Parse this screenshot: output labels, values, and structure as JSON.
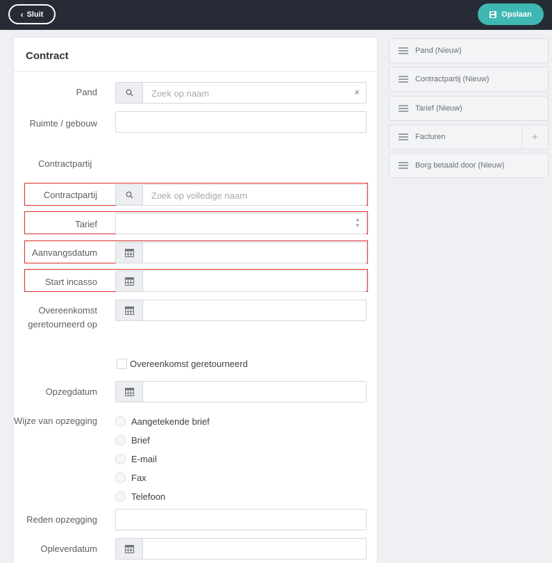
{
  "topbar": {
    "close_label": "Sluit",
    "save_label": "Opslaan"
  },
  "form": {
    "title": "Contract",
    "pand": {
      "label": "Pand",
      "placeholder": "Zoek op naam",
      "clear": "×"
    },
    "ruimte": {
      "label": "Ruimte / gebouw"
    },
    "contractpartij_section": "Contractpartij",
    "contractpartij": {
      "label": "Contractpartij",
      "placeholder": "Zoek op volledige naam"
    },
    "tarief": {
      "label": "Tarief"
    },
    "aanvangsdatum": {
      "label": "Aanvangsdatum"
    },
    "start_incasso": {
      "label": "Start incasso"
    },
    "overeenkomst_geretourneerd_op": {
      "label": "Overeenkomst geretourneerd op"
    },
    "overeenkomst_geretourneerd_checkbox": "Overeenkomst geretourneerd",
    "opzegdatum": {
      "label": "Opzegdatum"
    },
    "wijze_van_opzegging": {
      "label": "Wijze van opzegging",
      "options": [
        "Aangetekende brief",
        "Brief",
        "E-mail",
        "Fax",
        "Telefoon"
      ]
    },
    "reden_opzegging": {
      "label": "Reden opzegging"
    },
    "opleverdatum": {
      "label": "Opleverdatum"
    }
  },
  "sidebar": {
    "items": [
      {
        "label": "Pand (Nieuw)"
      },
      {
        "label": "Contractpartij (Nieuw)"
      },
      {
        "label": "Tarief (Nieuw)"
      },
      {
        "label": "Facturen",
        "action": "+"
      },
      {
        "label": "Borg betaald door (Nieuw)"
      }
    ]
  },
  "colors": {
    "topbar": "#262b35",
    "accent": "#3fb8b3",
    "highlight": "#d92b2b"
  }
}
